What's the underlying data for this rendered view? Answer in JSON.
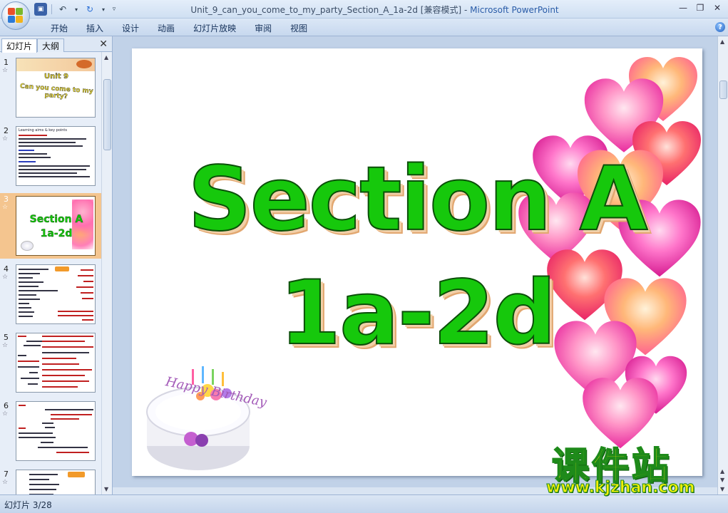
{
  "window": {
    "title": "Unit_9_can_you_come_to_my_party_Section_A_1a-2d [兼容模式]",
    "app_name": "Microsoft PowerPoint",
    "title_sep": " - "
  },
  "ribbon": {
    "tabs": [
      "开始",
      "插入",
      "设计",
      "动画",
      "幻灯片放映",
      "审阅",
      "视图"
    ]
  },
  "panel": {
    "tab_slides": "幻灯片",
    "tab_outline": "大纲",
    "close_glyph": "✕"
  },
  "thumbnails": [
    {
      "number": "1",
      "title_line1": "Unit 9",
      "title_line2": "Can you come to my party?"
    },
    {
      "number": "2",
      "heading": "Learning aims & key points"
    },
    {
      "number": "3",
      "line1": "Section A",
      "line2": "1a-2d",
      "selected": true
    },
    {
      "number": "4"
    },
    {
      "number": "5"
    },
    {
      "number": "6"
    },
    {
      "number": "7"
    }
  ],
  "slide": {
    "title_line1": "Section A",
    "title_line2": "1a-2d",
    "cake_text": "Happy Birthday",
    "title_color": "#16c80c"
  },
  "status": {
    "slide_indicator": "幻灯片 3/28"
  },
  "watermark": {
    "cn": "课件站",
    "url": "www.kjzhan.com"
  }
}
